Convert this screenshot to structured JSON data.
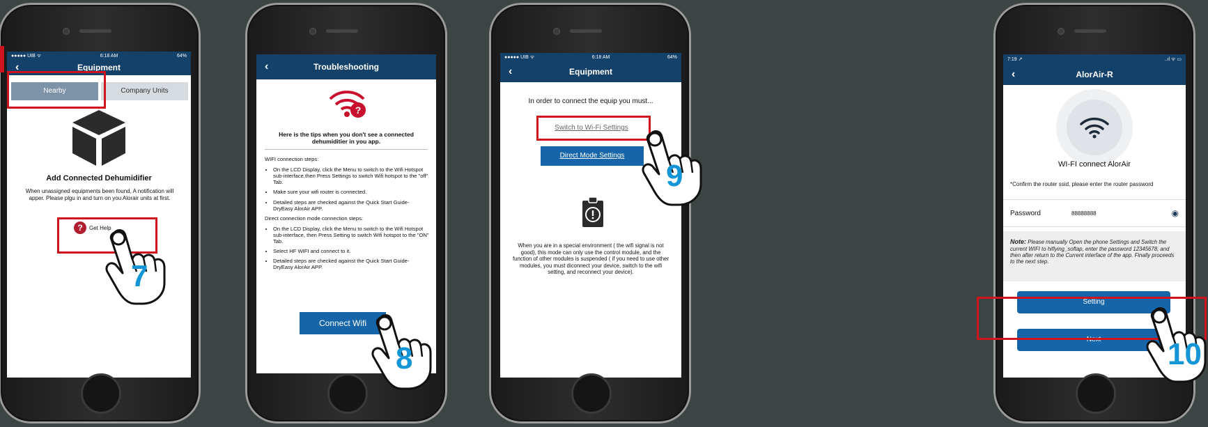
{
  "phone1": {
    "status": {
      "carrier": "●●●●● UIB ᯤ",
      "time": "6:18 AM",
      "battery": "64%"
    },
    "title": "Equipment",
    "tabs": [
      "Nearby",
      "Company Units"
    ],
    "heading": "Add Connected Dehumidifier",
    "message": "When unassigned equipments been found, A notification will apper. Please plgu in and turn on you Alorair units at first.",
    "help_label": "Get Help",
    "step": "7"
  },
  "phone2": {
    "title": "Troubleshooting",
    "tips_heading": "Here is the tips when you don't see a connected dehumiditier in you app.",
    "wifi_heading": "WIFI connection steps:",
    "wifi_steps": [
      "On the LCD Display, click the Menu to switch to the Wifi Hotspot sub-interface,then Press Settings to switch Wifi hotspot to the \"off\" Tab.",
      "Make sure your wifi router is connected.",
      "Detailed steps are checked against the Quick Start Guide-DryEasy AlorAir APP."
    ],
    "direct_heading": "Direct connection mode connection steps:",
    "direct_steps": [
      "On the LCD Display, click the Menu to switch to the Wifi Hotspot sub-interface, then Press Setting to switch Wifi hotspot to the \"ON\" Tab.",
      "Select HF WIFI and connect to it.",
      "Detailed steps are checked against the Quick Start Guide-DryEasy AlorAir APP."
    ],
    "connect_label": "Connect Wifi",
    "step": "8"
  },
  "phone3": {
    "status": {
      "carrier": "●●●●● UIB ᯤ",
      "time": "6:18 AM",
      "battery": "64%"
    },
    "title": "Equipment",
    "intro": "In order to connect the equip you must...",
    "wifi_settings_label": "Switch to Wi-Fi Settings",
    "direct_mode_label": "Direct Mode Settings",
    "note": "When you are in a special environment ( the wifi signal is not good), this mode can only use the control module, and the function of other modules is suspended ( if you need to use other modules, you must diconnect your device, switch to the wifi setting, and reconnect your device).",
    "step": "9"
  },
  "phone4": {
    "status": {
      "time": "7:19 ↗",
      "icons": "..ıl ᯤ ▭"
    },
    "title": "AlorAir-R",
    "connect_title": "WI-FI connect  AlorAir",
    "confirm_text": "*Confirm the router ssid, please enter the router password",
    "password_label": "Password",
    "password_value": "88888888",
    "note_label": "Note:",
    "note_text": "Please manually Open the phone Settings and Switch the current WIFI to hiflying_softap, enter the password 12345678, and then after return to the Current interface of the app. Finally proceeds to the next step.",
    "setting_label": "Setting",
    "next_label": "Next",
    "step": "10"
  },
  "colors": {
    "navbar": "#13416a",
    "button": "#1565a8",
    "highlight": "#d0141e",
    "step": "#1495d6",
    "help": "#b01e2f"
  }
}
